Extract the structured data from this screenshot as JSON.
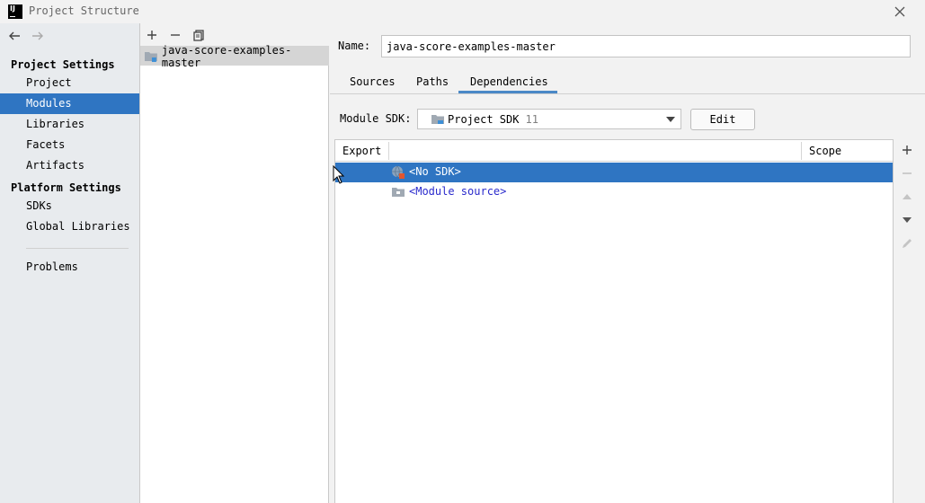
{
  "window": {
    "app_icon_text": "IJ",
    "title": "Project Structure"
  },
  "nav": {
    "back_icon": "arrow-left-icon",
    "forward_icon": "arrow-right-icon",
    "project_settings_header": "Project Settings",
    "project_settings_items": [
      "Project",
      "Modules",
      "Libraries",
      "Facets",
      "Artifacts"
    ],
    "platform_settings_header": "Platform Settings",
    "platform_settings_items": [
      "SDKs",
      "Global Libraries"
    ],
    "problems": "Problems",
    "selected_item": "Modules"
  },
  "modules": {
    "toolbar_icons": [
      "add-icon",
      "remove-icon",
      "copy-icon"
    ],
    "items": [
      "java-score-examples-master"
    ]
  },
  "module_settings": {
    "name_label": "Name:",
    "name_value": "java-score-examples-master",
    "tabs": [
      "Sources",
      "Paths",
      "Dependencies"
    ],
    "active_tab": "Dependencies",
    "sdk_label": "Module SDK:",
    "sdk_value": "Project SDK",
    "sdk_version": "11",
    "edit_button": "Edit"
  },
  "dependencies": {
    "columns": [
      "Export",
      "",
      "Scope"
    ],
    "rows": [
      {
        "name": "<No SDK>",
        "icon": "sdk-globe-icon",
        "selected": true
      },
      {
        "name": "<Module source>",
        "icon": "folder-icon",
        "selected": false
      }
    ],
    "side_tools": [
      "add-icon",
      "remove-icon",
      "move-up-icon",
      "move-down-icon",
      "edit-pencil-icon"
    ]
  },
  "colors": {
    "selection": "#2f75c2",
    "nav_background": "#e8ebee",
    "tab_underline": "#4a88c7",
    "link_text": "#2a2acc"
  }
}
